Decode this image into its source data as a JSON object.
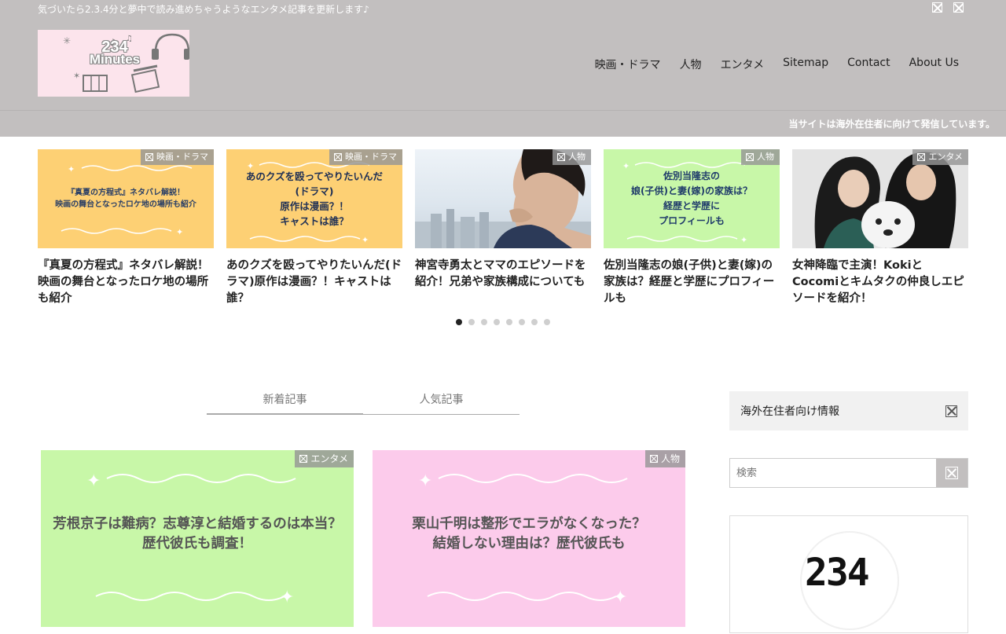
{
  "header": {
    "tagline": "気づいたら2.3.4分と夢中で読み進めちゃうようなエンタメ記事を更新します♪",
    "logo": {
      "number": "234",
      "word": "Minutes"
    },
    "top_icons": [
      "x-icon",
      "x-icon"
    ],
    "nav": [
      "映画・ドラマ",
      "人物",
      "エンタメ",
      "Sitemap",
      "Contact",
      "About Us"
    ]
  },
  "notice": "当サイトは海外在住者に向けて発信しています。",
  "carousel": {
    "slides": [
      {
        "category": "映画・ドラマ",
        "image_text": "『真夏の方程式』ネタバレ解説！\n映画の舞台となったロケ地の場所も紹介",
        "title": "『真夏の方程式』ネタバレ解説！映画の舞台となったロケ地の場所も紹介"
      },
      {
        "category": "映画・ドラマ",
        "image_text": "あのクズを殴ってやりたいんだ\n(ドラマ)\n原作は漫画？！\nキャストは誰？",
        "title": "あのクズを殴ってやりたいんだ(ドラマ)原作は漫画？！キャストは誰？"
      },
      {
        "category": "人物",
        "image_text": "",
        "title": "神宮寺勇太とママのエピソードを紹介！兄弟や家族構成についても"
      },
      {
        "category": "人物",
        "image_text": "佐別当隆志の\n娘(子供)と妻(嫁)の家族は？\n経歴と学歴に\nプロフィールも",
        "title": "佐別当隆志の娘(子供)と妻(嫁)の家族は？経歴と学歴にプロフィールも"
      },
      {
        "category": "エンタメ",
        "image_text": "",
        "title": "女神降臨で主演！KokiとCocomiとキムタクの仲良しエピソードを紹介！"
      }
    ],
    "dots_total": 8,
    "dots_active": 1
  },
  "tabs": [
    "新着記事",
    "人気記事"
  ],
  "cards": [
    {
      "category": "エンタメ",
      "text": "芳根京子は難病？志尊淳と結婚するのは本当？\n歴代彼氏も調査！"
    },
    {
      "category": "人物",
      "text": "栗山千明は整形でエラがなくなった？\n結婚しない理由は？歴代彼氏も"
    }
  ],
  "sidebar": {
    "box_label": "海外在住者向け情報",
    "search_placeholder": "検索",
    "widget_logo": "234"
  },
  "colors": {
    "header_bg": "#c2bfbf",
    "logo_bg": "#fce4ec",
    "yellow_thumb": "#fdd074",
    "green_thumb": "#c8f7a8",
    "pink_thumb": "#fccbeb"
  }
}
